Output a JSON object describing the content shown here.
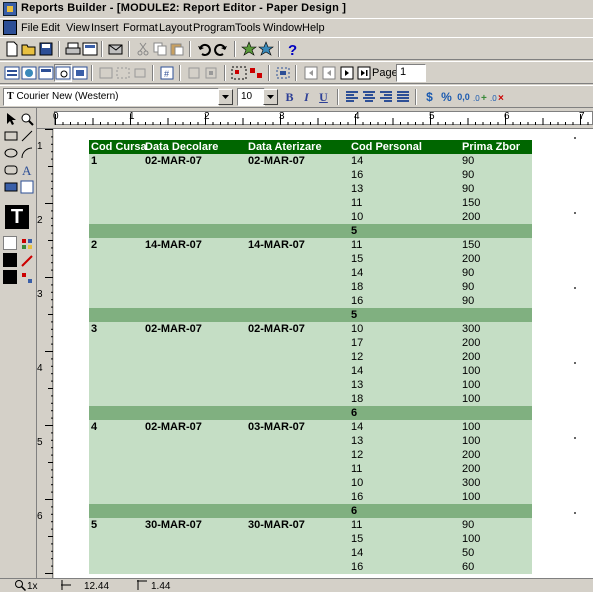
{
  "app": {
    "title": "Reports Builder - [MODULE2: Report Editor - Paper Design ]"
  },
  "menu": [
    "File",
    "Edit",
    "View",
    "Insert",
    "Format",
    "Layout",
    "Program",
    "Tools",
    "Window",
    "Help"
  ],
  "toolbar2": {
    "page_label": "Page:",
    "page_value": "1"
  },
  "font": {
    "name": "Courier New (Western)",
    "size": "10"
  },
  "format_buttons": {
    "bold": "B",
    "italic": "I",
    "underline": "U",
    "currency": "$",
    "percent": "%",
    "commas": "0,0"
  },
  "ruler_h": [
    "0",
    "1",
    "2",
    "3",
    "4",
    "5",
    "6",
    "7"
  ],
  "ruler_v": [
    "1",
    "2",
    "3",
    "4",
    "5",
    "6"
  ],
  "report": {
    "headers": [
      "Cod Cursa",
      "Data Decolare",
      "Data Aterizare",
      "Cod Personal",
      "Prima Zbor"
    ],
    "groups": [
      {
        "cursa": "1",
        "decolare": "02-MAR-07",
        "aterizare": "02-MAR-07",
        "rows": [
          [
            "14",
            "90"
          ],
          [
            "16",
            "90"
          ],
          [
            "13",
            "90"
          ],
          [
            "11",
            "150"
          ],
          [
            "10",
            "200"
          ]
        ],
        "count": "5"
      },
      {
        "cursa": "2",
        "decolare": "14-MAR-07",
        "aterizare": "14-MAR-07",
        "rows": [
          [
            "11",
            "150"
          ],
          [
            "15",
            "200"
          ],
          [
            "14",
            "90"
          ],
          [
            "18",
            "90"
          ],
          [
            "16",
            "90"
          ]
        ],
        "count": "5"
      },
      {
        "cursa": "3",
        "decolare": "02-MAR-07",
        "aterizare": "02-MAR-07",
        "rows": [
          [
            "10",
            "300"
          ],
          [
            "17",
            "200"
          ],
          [
            "12",
            "200"
          ],
          [
            "14",
            "100"
          ],
          [
            "13",
            "100"
          ],
          [
            "18",
            "100"
          ]
        ],
        "count": "6"
      },
      {
        "cursa": "4",
        "decolare": "02-MAR-07",
        "aterizare": "03-MAR-07",
        "rows": [
          [
            "14",
            "100"
          ],
          [
            "13",
            "100"
          ],
          [
            "12",
            "200"
          ],
          [
            "11",
            "200"
          ],
          [
            "10",
            "300"
          ],
          [
            "16",
            "100"
          ]
        ],
        "count": "6"
      },
      {
        "cursa": "5",
        "decolare": "30-MAR-07",
        "aterizare": "30-MAR-07",
        "rows": [
          [
            "11",
            "90"
          ],
          [
            "15",
            "100"
          ],
          [
            "14",
            "50"
          ],
          [
            "16",
            "60"
          ]
        ],
        "count": ""
      }
    ]
  },
  "status": {
    "zoom": "1x",
    "pos_x": "12.44",
    "pos_y": "1.44"
  },
  "colors": {
    "header_bg": "#006600",
    "row_bg": "#c5dec5",
    "summary_bg": "#80b080"
  }
}
